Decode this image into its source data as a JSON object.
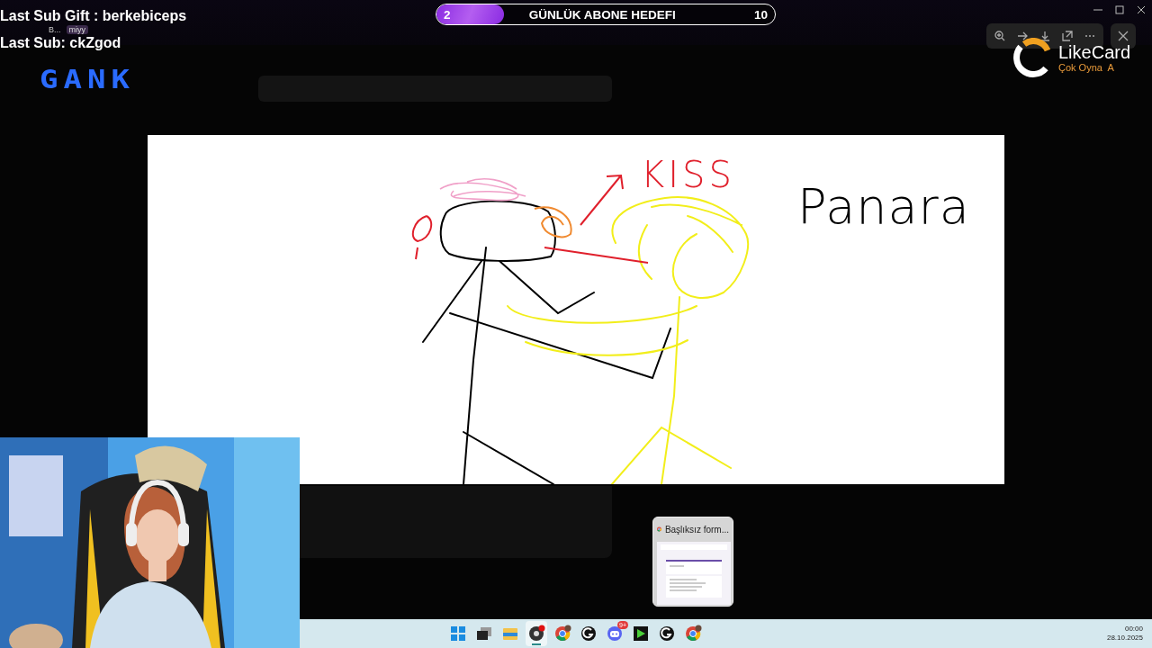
{
  "overlay": {
    "last_sub_gift": "Last Sub Gift : berkebiceps",
    "chat_user": "B...",
    "chat_badge": "miyy",
    "last_sub": "Last Sub: ckZgod",
    "logo": "GANK"
  },
  "goal": {
    "current": "2",
    "title": "GÜNLÜK ABONE HEDEFI",
    "target": "10",
    "level": 0.2
  },
  "sponsor": {
    "name": "LikeCard",
    "tagline": "Çok Oyna  A"
  },
  "drawing": {
    "labels": [
      {
        "text": "KISS",
        "color": "#e0202c"
      },
      {
        "text": "Panara",
        "color": "#000000"
      }
    ]
  },
  "preview": {
    "title": "Başlıksız form..."
  },
  "taskbar": {
    "apps": [
      {
        "kind": "start",
        "active": false
      },
      {
        "kind": "taskview",
        "active": false
      },
      {
        "kind": "files",
        "active": false
      },
      {
        "kind": "obs",
        "active": true
      },
      {
        "kind": "chrome",
        "active": false
      },
      {
        "kind": "ghub",
        "active": false
      },
      {
        "kind": "discord",
        "active": false,
        "badge": "9+"
      },
      {
        "kind": "media",
        "active": false
      },
      {
        "kind": "ghub",
        "active": false
      },
      {
        "kind": "chrome",
        "active": false
      }
    ],
    "time": "00:00",
    "date": "28.10.2025"
  }
}
